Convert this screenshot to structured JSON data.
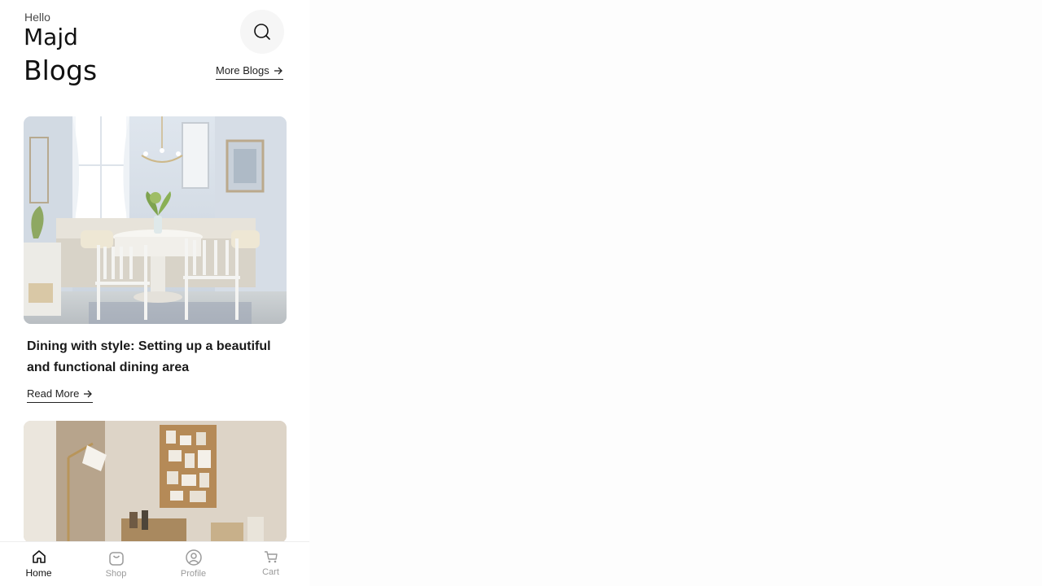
{
  "header": {
    "greeting": "Hello",
    "username": "Majd",
    "search_icon": "search-icon"
  },
  "blogs": {
    "title": "Blogs",
    "more_label": "More Blogs",
    "posts": [
      {
        "image": "dining-room-photo",
        "title": "Dining with style: Setting up a beautiful and functional dining area",
        "read_more_label": "Read More"
      },
      {
        "image": "home-office-photo"
      }
    ]
  },
  "nav": {
    "active": "Home",
    "items": [
      {
        "label": "Home",
        "icon": "home-icon"
      },
      {
        "label": "Shop",
        "icon": "shopping-bag-icon"
      },
      {
        "label": "Profile",
        "icon": "profile-icon"
      },
      {
        "label": "Cart",
        "icon": "cart-icon"
      }
    ]
  },
  "colors": {
    "text_primary": "#111111",
    "text_muted": "#9a9a9a",
    "background": "#ffffff",
    "search_bg": "#f6f6f6"
  }
}
